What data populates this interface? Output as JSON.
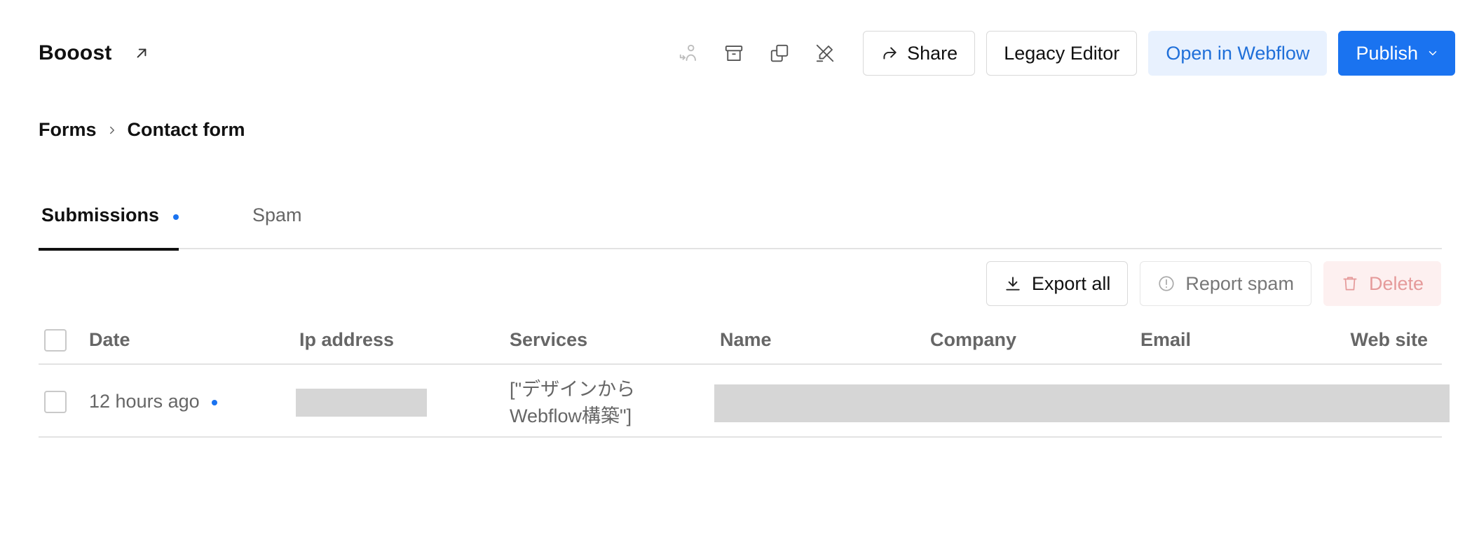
{
  "header": {
    "site_name": "Booost",
    "icons": [
      "external-link-icon",
      "reassign-icon",
      "archive-icon",
      "duplicate-icon",
      "edit-disabled-icon"
    ],
    "share_label": "Share",
    "legacy_editor_label": "Legacy Editor",
    "open_webflow_label": "Open in Webflow",
    "publish_label": "Publish"
  },
  "breadcrumb": {
    "parent": "Forms",
    "current": "Contact form"
  },
  "tabs": [
    {
      "label": "Submissions",
      "active": true,
      "has_new_indicator": true
    },
    {
      "label": "Spam",
      "active": false
    }
  ],
  "toolbar": {
    "export_label": "Export all",
    "report_spam_label": "Report spam",
    "delete_label": "Delete"
  },
  "table": {
    "columns": [
      "Date",
      "Ip address",
      "Services",
      "Name",
      "Company",
      "Email",
      "Web site"
    ],
    "rows": [
      {
        "date": "12 hours ago",
        "is_new": true,
        "services_line1": "[\"デザインから",
        "services_line2": "Webflow構築\"]"
      }
    ]
  },
  "colors": {
    "accent": "#1a73f0",
    "accent_light": "#e8f1fe",
    "delete_text": "#e59a9a",
    "redacted": "#d6d6d6"
  }
}
